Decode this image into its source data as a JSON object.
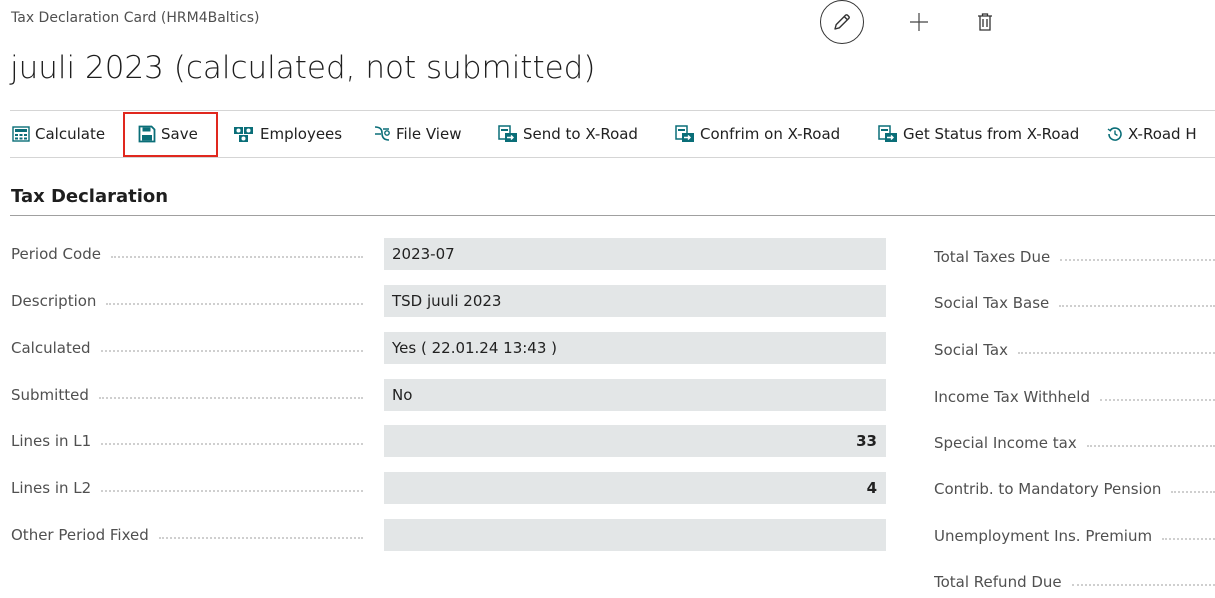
{
  "header": {
    "breadcrumb": "Tax Declaration Card (HRM4Baltics)",
    "title": "juuli 2023 (calculated, not submitted)"
  },
  "toolbar": {
    "calculate": "Calculate",
    "save": "Save",
    "employees": "Employees",
    "file_view": "File View",
    "send_xroad": "Send to X-Road",
    "confirm_xroad": "Confrim on X-Road",
    "status_xroad": "Get Status from X-Road",
    "xroad_history": "X-Road H"
  },
  "section": {
    "title": "Tax Declaration"
  },
  "fields": [
    {
      "label": "Period Code",
      "value": "2023-07"
    },
    {
      "label": "Description",
      "value": "TSD juuli 2023"
    },
    {
      "label": "Calculated",
      "value": "Yes ( 22.01.24 13:43 )"
    },
    {
      "label": "Submitted",
      "value": "No"
    },
    {
      "label": "Lines in L1",
      "value": "33"
    },
    {
      "label": "Lines in L2",
      "value": "4"
    },
    {
      "label": "Other Period Fixed",
      "value": ""
    }
  ],
  "right_fields": [
    "Total Taxes Due",
    "Social Tax Base",
    "Social Tax",
    "Income Tax Withheld",
    "Special Income tax",
    "Contrib. to Mandatory Pension",
    "Unemployment Ins. Premium",
    "Total Refund Due"
  ],
  "colors": {
    "highlight": "#e0281e",
    "accent": "#0a6e78",
    "field_bg": "#e3e6e7"
  }
}
